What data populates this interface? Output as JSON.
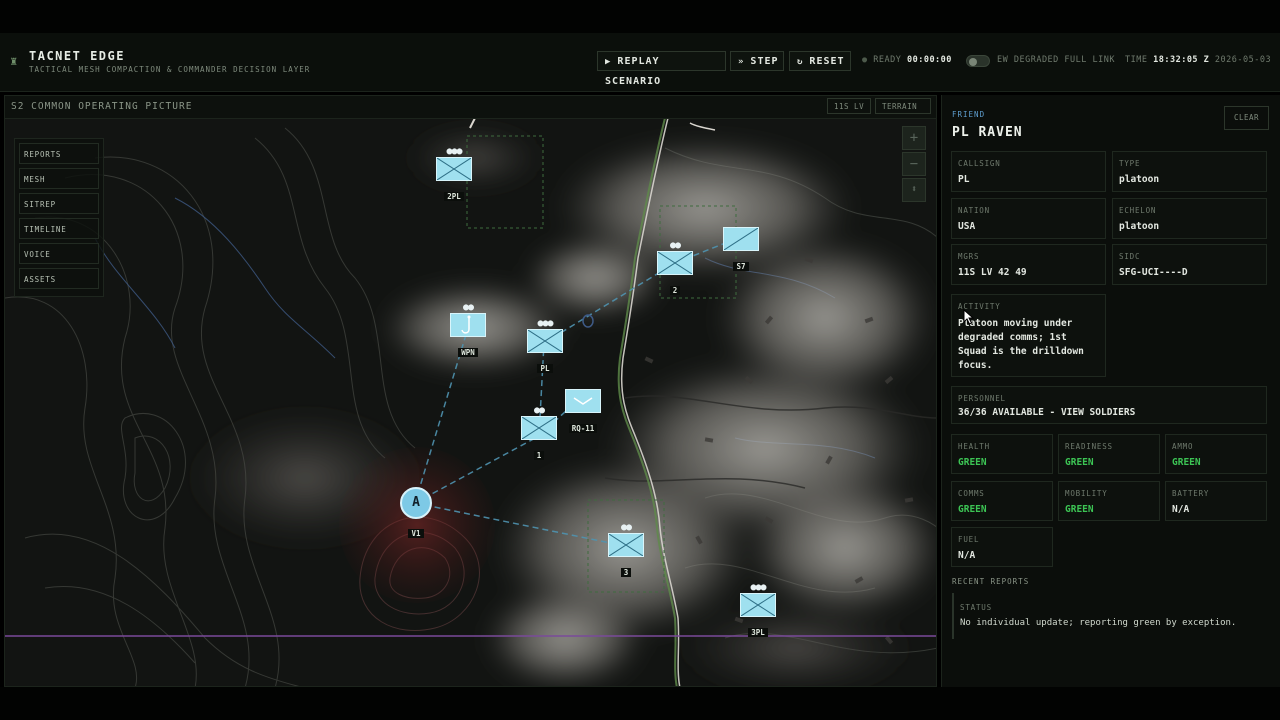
{
  "header": {
    "title": "TACNET EDGE",
    "subtitle": "TACTICAL MESH COMPACTION & COMMANDER DECISION LAYER",
    "buttons": {
      "replay": "REPLAY SCENARIO",
      "step": "STEP",
      "reset": "RESET"
    },
    "status_ready": "READY",
    "elapsed": "00:00:00",
    "link_state": "EW DEGRADED FULL LINK",
    "time_label": "TIME",
    "time_value": "18:32:05 Z",
    "date": "2026-05-03"
  },
  "map": {
    "title": "S2 COMMON OPERATING PICTURE",
    "chips": [
      "11S LV",
      "TERRAIN"
    ],
    "nav": [
      "REPORTS",
      "MESH",
      "SITREP",
      "TIMELINE",
      "VOICE",
      "ASSETS"
    ],
    "zoom": {
      "in": "+",
      "out": "−"
    },
    "units": [
      {
        "label": "2PL",
        "dots": "●●●",
        "kind": "infantry"
      },
      {
        "label": "S7",
        "dots": "",
        "kind": "infantry"
      },
      {
        "label": "2",
        "dots": "●●",
        "kind": "infantry"
      },
      {
        "label": "WPN",
        "dots": "●●",
        "kind": "weapons"
      },
      {
        "label": "PL",
        "dots": "●●●",
        "kind": "infantry"
      },
      {
        "label": "RQ-11",
        "dots": "",
        "kind": "uav"
      },
      {
        "label": "1",
        "dots": "●●",
        "kind": "infantry"
      },
      {
        "label": "V1",
        "dots": "",
        "kind": "vehicle",
        "glyph": "A"
      },
      {
        "label": "3",
        "dots": "●●",
        "kind": "infantry"
      },
      {
        "label": "3PL",
        "dots": "●●●",
        "kind": "infantry"
      }
    ]
  },
  "panel": {
    "affiliation": "FRIEND",
    "name": "PL RAVEN",
    "clear": "CLEAR",
    "fields": {
      "callsign": {
        "k": "CALLSIGN",
        "v": "PL"
      },
      "type": {
        "k": "TYPE",
        "v": "platoon"
      },
      "nation": {
        "k": "NATION",
        "v": "USA"
      },
      "echelon": {
        "k": "ECHELON",
        "v": "platoon"
      },
      "mgrs": {
        "k": "MGRS",
        "v": "11S LV 42 49"
      },
      "sidc": {
        "k": "SIDC",
        "v": "SFG-UCI----D"
      },
      "activity": {
        "k": "ACTIVITY",
        "v": "Platoon moving under degraded comms; 1st Squad is the drilldown focus."
      },
      "personnel": {
        "k": "PERSONNEL",
        "v": "36/36 AVAILABLE - VIEW SOLDIERS"
      }
    },
    "status": {
      "health": {
        "k": "HEALTH",
        "v": "GREEN"
      },
      "readiness": {
        "k": "READINESS",
        "v": "GREEN"
      },
      "ammo": {
        "k": "AMMO",
        "v": "GREEN"
      },
      "comms": {
        "k": "COMMS",
        "v": "GREEN"
      },
      "mobility": {
        "k": "MOBILITY",
        "v": "GREEN"
      },
      "battery": {
        "k": "BATTERY",
        "v": "N/A"
      },
      "fuel": {
        "k": "FUEL",
        "v": "N/A"
      }
    },
    "recent_title": "RECENT REPORTS",
    "report": {
      "k": "STATUS",
      "v": "No individual update; reporting green by exception."
    }
  },
  "colors": {
    "accent_green": "#3cc454",
    "friend_blue": "#9fe0ef",
    "friend_label": "#5f9fd0",
    "threat_red": "#8a2a2a"
  }
}
